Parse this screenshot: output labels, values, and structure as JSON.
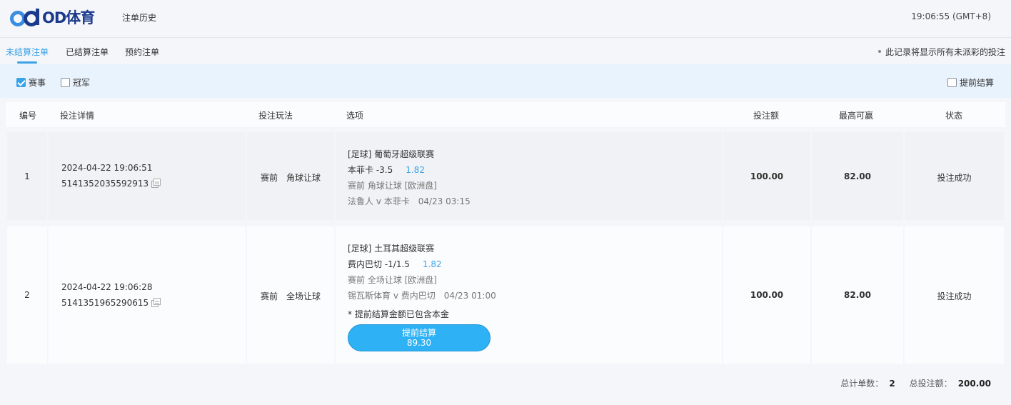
{
  "header": {
    "logo_text": "OD体育",
    "nav_history": "注单历史",
    "clock": "19:06:55 (GMT+8)"
  },
  "tabs": [
    {
      "label": "未结算注单",
      "active": true
    },
    {
      "label": "已结算注单",
      "active": false
    },
    {
      "label": "预约注单",
      "active": false
    }
  ],
  "tab_note": "此记录将显示所有未派彩的投注",
  "filters": {
    "event": {
      "label": "赛事",
      "checked": true
    },
    "champion": {
      "label": "冠军",
      "checked": false
    },
    "early_settle": {
      "label": "提前结算",
      "checked": false
    }
  },
  "table": {
    "headers": {
      "no": "编号",
      "detail": "投注详情",
      "play": "投注玩法",
      "option": "选项",
      "amount": "投注额",
      "max_win": "最高可赢",
      "status": "状态"
    },
    "rows": [
      {
        "no": "1",
        "time": "2024-04-22 19:06:51",
        "bet_id": "5141352035592913",
        "play": "赛前　角球让球",
        "league": "[足球] 葡萄牙超级联赛",
        "pick": "本菲卡 -3.5",
        "odds": "1.82",
        "market": "赛前 角球让球 [欧洲盘]",
        "match": "法鲁人 v 本菲卡",
        "match_time": "04/23 03:15",
        "amount": "100.00",
        "max_win": "82.00",
        "status": "投注成功"
      },
      {
        "no": "2",
        "time": "2024-04-22 19:06:28",
        "bet_id": "5141351965290615",
        "play": "赛前　全场让球",
        "league": "[足球] 土耳其超级联赛",
        "pick": "费内巴切 -1/1.5",
        "odds": "1.82",
        "market": "赛前 全场让球 [欧洲盘]",
        "match": "锡瓦斯体育 v 费内巴切",
        "match_time": "04/23 01:00",
        "note": "* 提前结算金额已包含本金",
        "cashout_label": "提前结算",
        "cashout_value": "89.30",
        "amount": "100.00",
        "max_win": "82.00",
        "status": "投注成功"
      }
    ]
  },
  "footer": {
    "count_label": "总计单数：",
    "count": "2",
    "total_label": "总投注额：",
    "total": "200.00"
  },
  "colors": {
    "accent": "#3aa3e8",
    "cashout_button": "#2fb1f5",
    "filter_bg": "#e9f3fd",
    "logo": "#1b3a8c"
  }
}
